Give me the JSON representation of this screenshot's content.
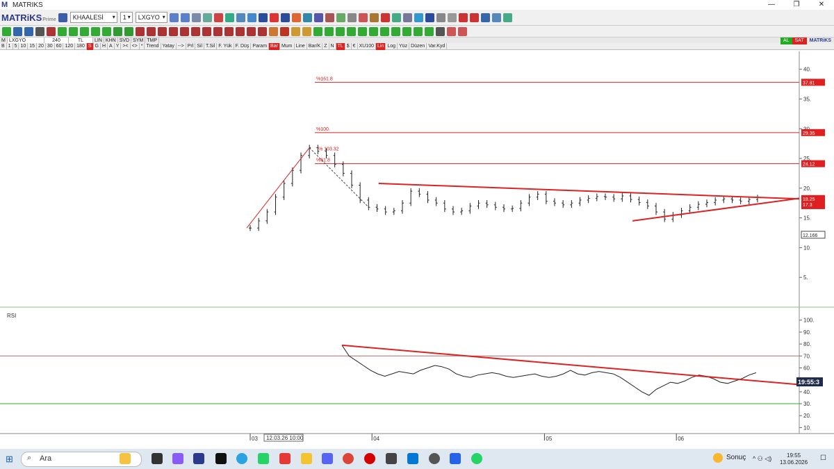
{
  "window": {
    "title": "MATRIKS",
    "min": "—",
    "max": "❐",
    "close": "✕"
  },
  "toolbar": {
    "brand": "MATRiKS",
    "brand_sub": "Prime",
    "market_combo": "KHAALESİ",
    "period_combo": "1",
    "symbol_combo": "LXGYO"
  },
  "chart_toolbar": {
    "symbol": "LXGYO",
    "period": "240",
    "currency": "TL",
    "scale_items": [
      "LIN",
      "KHN",
      "SVD",
      "SYM",
      "TMP"
    ],
    "buttons": [
      "B",
      "1",
      "5",
      "10",
      "15",
      "20",
      "30",
      "60",
      "120",
      "180",
      "S",
      "G",
      "H",
      "A",
      "Y",
      "><",
      "<>",
      "*",
      "Trend",
      "Yatay",
      "-->",
      "Prl",
      "Sil",
      "T.Sil",
      "F. Yük",
      "F. Düş",
      "Param",
      "Bar",
      "Mum",
      "Line",
      "Bar/K",
      "Z",
      "N",
      "TL",
      "$",
      "€",
      "XU100",
      "Lin",
      "Log",
      "Yüz",
      "Düzen",
      "Var.Kyd"
    ],
    "al": "AL",
    "sat": "SAT",
    "brand": "MATRiKS"
  },
  "chart_data": [
    {
      "type": "ohlc",
      "symbol": "LXGYO",
      "period": "240",
      "y_ticks": [
        5,
        10,
        15,
        20,
        25,
        30,
        35,
        40
      ],
      "ylim": [
        0,
        43
      ],
      "x_labels": [
        "03",
        "04",
        "05",
        "06"
      ],
      "crosshair_date": "12.03.26 10:00",
      "close_approx": [
        13.3,
        14.5,
        16.0,
        18.5,
        20.8,
        23.0,
        25.5,
        26.8,
        26.2,
        25.5,
        24.0,
        22.5,
        20.5,
        18.0,
        16.8,
        16.5,
        16.0,
        16.2,
        17.5,
        19.5,
        19.0,
        18.0,
        17.5,
        16.5,
        16.0,
        16.2,
        17.0,
        17.5,
        17.2,
        16.8,
        16.5,
        16.6,
        17.5,
        18.5,
        19.0,
        17.8,
        17.5,
        17.2,
        17.5,
        18.0,
        18.3,
        18.6,
        18.5,
        18.2,
        18.7,
        18.1,
        17.6,
        17.0,
        16.0,
        14.8,
        15.5,
        16.2,
        16.8,
        17.3,
        17.6,
        18.0,
        18.2,
        18.0,
        17.8,
        18.1,
        18.4
      ],
      "fibonacci": [
        {
          "label": "%161.8",
          "value": 37.81
        },
        {
          "label": "%100.",
          "value": 29.35
        },
        {
          "label": "%61.8",
          "value": 24.12
        }
      ],
      "peak_label": "% 103.32",
      "price_labels": [
        "37.81",
        "29.35",
        "24.12",
        "18.25",
        "17.3",
        "12.166"
      ],
      "trendlines": [
        {
          "name": "resistance",
          "from": [
            0.47,
            20.8
          ],
          "to": [
            1.0,
            18.2
          ]
        },
        {
          "name": "support",
          "from": [
            0.79,
            14.5
          ],
          "to": [
            1.0,
            18.3
          ]
        }
      ]
    },
    {
      "type": "line",
      "title": "RSI",
      "y_ticks": [
        10,
        20,
        30,
        40,
        50,
        60,
        70,
        80,
        90,
        100
      ],
      "ylim": [
        5,
        108
      ],
      "levels": [
        70,
        30
      ],
      "values": [
        79,
        70,
        66,
        62,
        58,
        55,
        53,
        55,
        57,
        56,
        55,
        58,
        60,
        62,
        61,
        59,
        55,
        53,
        52,
        54,
        55,
        56,
        55,
        53,
        52,
        53,
        54,
        55,
        53,
        52,
        53,
        55,
        58,
        55,
        54,
        56,
        57,
        56,
        55,
        52,
        48,
        44,
        40,
        37,
        42,
        45,
        48,
        47,
        49,
        52,
        54,
        53,
        51,
        48,
        47,
        49,
        51,
        54,
        56
      ],
      "current_time": "19:55:3"
    }
  ],
  "taskbar": {
    "search_placeholder": "Ara",
    "weather": "Sonuç",
    "time": "19:55",
    "date": "13.06.2026"
  }
}
